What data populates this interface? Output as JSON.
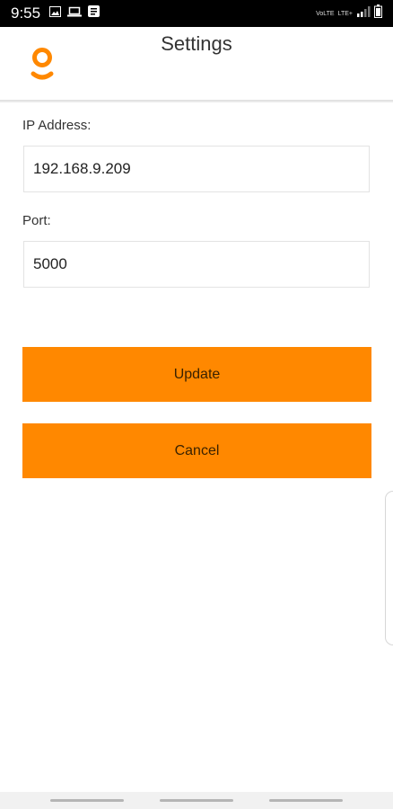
{
  "status_bar": {
    "time": "9:55",
    "left_icons": [
      "image-icon",
      "laptop-icon",
      "message-icon"
    ],
    "network_labels": [
      "VoLTE",
      "LTE+"
    ],
    "right_icons": [
      "signal-icon",
      "battery-icon"
    ]
  },
  "header": {
    "title": "Settings",
    "logo_icon": "logo-g-icon"
  },
  "form": {
    "ip_label": "IP Address:",
    "ip_value": "192.168.9.209",
    "port_label": "Port:",
    "port_value": "5000"
  },
  "buttons": {
    "update_label": "Update",
    "cancel_label": "Cancel"
  },
  "colors": {
    "accent": "#ff8800",
    "status_bar": "#000000"
  }
}
